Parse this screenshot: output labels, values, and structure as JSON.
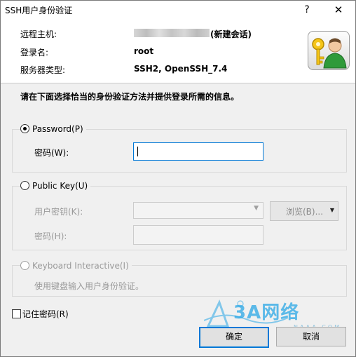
{
  "window": {
    "title": "SSH用户身份验证",
    "help": "?",
    "close": "✕"
  },
  "info": {
    "host_label": "远程主机:",
    "host_suffix": "(新建会话)",
    "login_label": "登录名:",
    "login_value": "root",
    "server_label": "服务器类型:",
    "server_value": "SSH2, OpenSSH_7.4"
  },
  "instruction": "请在下面选择恰当的身份验证方法并提供登录所需的信息。",
  "password_group": {
    "radio_label": "Password(P)",
    "selected": true,
    "field_label": "密码(W):",
    "field_value": ""
  },
  "publickey_group": {
    "radio_label": "Public Key(U)",
    "selected": false,
    "key_label": "用户密钥(K):",
    "browse_label": "浏览(B)...",
    "passphrase_label": "密码(H):"
  },
  "keyboard_group": {
    "radio_label": "Keyboard Interactive(I)",
    "selected": false,
    "description": "使用键盘输入用户身份验证。"
  },
  "remember": {
    "label": "记住密码(R)",
    "checked": false
  },
  "buttons": {
    "ok": "确定",
    "cancel": "取消"
  },
  "watermark": {
    "brand": "3A网络",
    "sub": "NAAA.COM"
  },
  "colors": {
    "focus": "#0078d7",
    "watermark": "#2aa7e6"
  }
}
